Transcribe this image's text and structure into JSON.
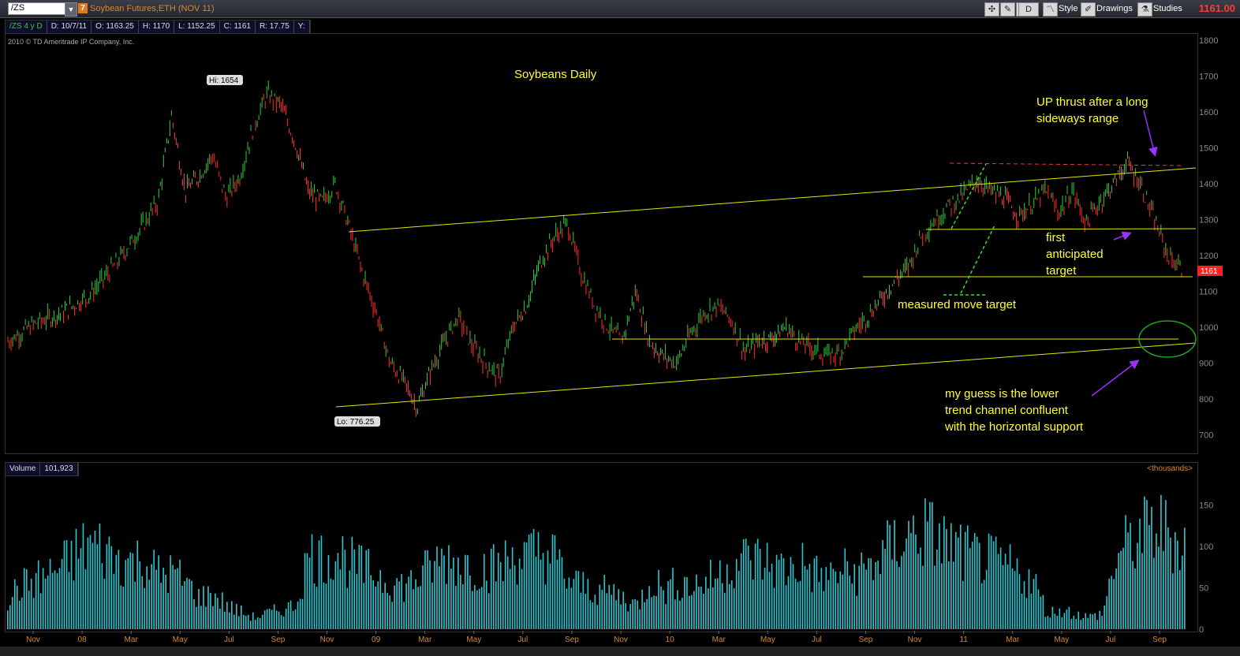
{
  "toolbar": {
    "symbol": "/ZS",
    "badge": "7",
    "description": "Soybean Futures,ETH (NOV 11)",
    "period_button": "D",
    "style_label": "Style",
    "drawings_label": "Drawings",
    "studies_label": "Studies",
    "last_price": "1161.00",
    "colors": {
      "last_price": "#ff3b3b",
      "symbol_desc": "#d58a2e"
    }
  },
  "infobar": {
    "study": "/ZS 4 y D",
    "date": "D: 10/7/11",
    "open": "O: 1163.25",
    "high": "H: 1170",
    "low": "L: 1152.25",
    "close": "C: 1161",
    "range": "R: 17.75",
    "y": "Y:"
  },
  "copyright": "2010 © TD Ameritrade IP Company, Inc.",
  "chart_data": [
    {
      "type": "line",
      "title": "Soybeans Daily",
      "ylim": [
        650,
        1820
      ],
      "y_ticks": [
        700,
        800,
        900,
        1000,
        1100,
        1200,
        1300,
        1400,
        1500,
        1600,
        1700,
        1800
      ],
      "x_ticks": [
        "Nov",
        "08",
        "Mar",
        "May",
        "Jul",
        "Sep",
        "Nov",
        "09",
        "Mar",
        "May",
        "Jul",
        "Sep",
        "Nov",
        "10",
        "Mar",
        "May",
        "Jul",
        "Sep",
        "Nov",
        "11",
        "Mar",
        "May",
        "Jul",
        "Sep"
      ],
      "price_path": [
        [
          0,
          960
        ],
        [
          2,
          1010
        ],
        [
          4,
          1040
        ],
        [
          6,
          1090
        ],
        [
          8,
          1180
        ],
        [
          10,
          1290
        ],
        [
          11,
          1350
        ],
        [
          12,
          1590
        ],
        [
          13,
          1380
        ],
        [
          14,
          1420
        ],
        [
          15,
          1480
        ],
        [
          16,
          1360
        ],
        [
          17,
          1420
        ],
        [
          18,
          1560
        ],
        [
          19,
          1650
        ],
        [
          20,
          1620
        ],
        [
          21,
          1520
        ],
        [
          22,
          1380
        ],
        [
          23,
          1350
        ],
        [
          24,
          1400
        ],
        [
          25,
          1280
        ],
        [
          26,
          1150
        ],
        [
          27,
          1040
        ],
        [
          28,
          900
        ],
        [
          29,
          850
        ],
        [
          30,
          776
        ],
        [
          31,
          880
        ],
        [
          32,
          960
        ],
        [
          33,
          1030
        ],
        [
          34,
          950
        ],
        [
          35,
          900
        ],
        [
          36,
          860
        ],
        [
          37,
          1000
        ],
        [
          38,
          1060
        ],
        [
          39,
          1180
        ],
        [
          40,
          1250
        ],
        [
          41,
          1290
        ],
        [
          42,
          1150
        ],
        [
          43,
          1060
        ],
        [
          44,
          1000
        ],
        [
          45,
          960
        ],
        [
          46,
          1100
        ],
        [
          47,
          960
        ],
        [
          48,
          920
        ],
        [
          49,
          900
        ],
        [
          50,
          980
        ],
        [
          51,
          1040
        ],
        [
          52,
          1060
        ],
        [
          53,
          1020
        ],
        [
          54,
          930
        ],
        [
          55,
          960
        ],
        [
          56,
          970
        ],
        [
          57,
          1000
        ],
        [
          58,
          960
        ],
        [
          59,
          940
        ],
        [
          60,
          920
        ],
        [
          61,
          930
        ],
        [
          62,
          990
        ],
        [
          63,
          1030
        ],
        [
          64,
          1080
        ],
        [
          65,
          1130
        ],
        [
          66,
          1170
        ],
        [
          67,
          1260
        ],
        [
          68,
          1300
        ],
        [
          69,
          1340
        ],
        [
          70,
          1370
        ],
        [
          71,
          1410
        ],
        [
          72,
          1380
        ],
        [
          73,
          1360
        ],
        [
          74,
          1310
        ],
        [
          75,
          1340
        ],
        [
          76,
          1380
        ],
        [
          77,
          1320
        ],
        [
          78,
          1380
        ],
        [
          79,
          1290
        ],
        [
          80,
          1350
        ],
        [
          81,
          1400
        ],
        [
          82,
          1460
        ],
        [
          83,
          1400
        ],
        [
          84,
          1300
        ],
        [
          85,
          1200
        ],
        [
          86,
          1161
        ]
      ],
      "annotations": {
        "hi_label": "Hi: 1654",
        "lo_label": "Lo: 776.25",
        "last_tag": "1161",
        "up_thrust": [
          "UP thrust after a long",
          "sideways range"
        ],
        "first_target": [
          "first",
          "anticipated",
          "target"
        ],
        "measured_move": "measured move target",
        "guess": [
          "my guess is the lower",
          "trend channel confluent",
          "with the horizontal support"
        ]
      },
      "colors": {
        "up_bar": "#2ecc40",
        "down_bar": "#ff3030",
        "trendline": "#e6e600",
        "resistance": "#ff3333",
        "measured_move": "#33dd33",
        "arrow": "#9933ff",
        "circle": "#1fa51f"
      }
    },
    {
      "type": "bar",
      "title": "",
      "label": "Volume",
      "last_volume": "101,923",
      "units": "<thousands>",
      "ylim": [
        0,
        185
      ],
      "y_ticks": [
        0,
        50,
        100,
        150
      ],
      "values": [
        40,
        55,
        62,
        70,
        80,
        95,
        110,
        100,
        90,
        85,
        88,
        70,
        72,
        60,
        40,
        45,
        30,
        22,
        15,
        20,
        25,
        30,
        95,
        90,
        100,
        85,
        75,
        70,
        60,
        55,
        65,
        80,
        90,
        85,
        80,
        78,
        80,
        95,
        92,
        100,
        90,
        60,
        55,
        50,
        48,
        40,
        30,
        65,
        50,
        60,
        55,
        60,
        70,
        85,
        90,
        88,
        80,
        75,
        85,
        70,
        65,
        75,
        70,
        80,
        95,
        110,
        120,
        125,
        115,
        105,
        95,
        90,
        85,
        80,
        70,
        60,
        20,
        25,
        20,
        15,
        20,
        90,
        110,
        120,
        130,
        120,
        110
      ]
    }
  ]
}
